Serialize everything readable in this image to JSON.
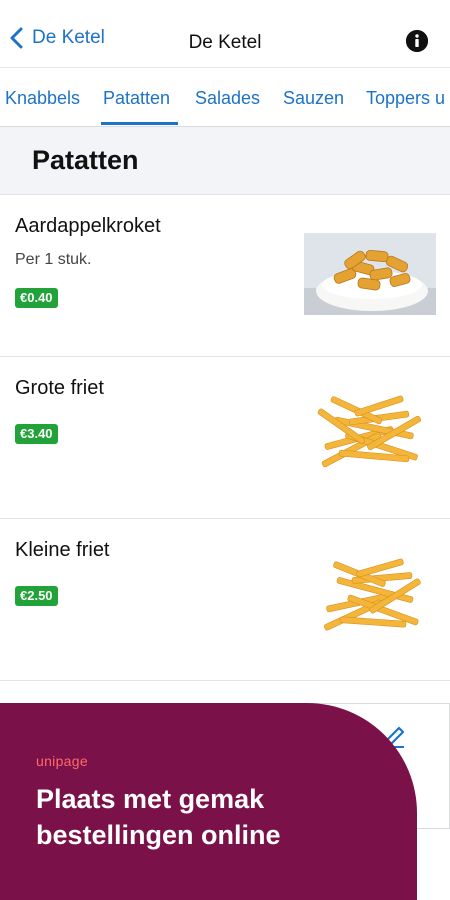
{
  "header": {
    "back_label": "De Ketel",
    "title": "De Ketel"
  },
  "tabs": [
    {
      "label": "Knabbels"
    },
    {
      "label": "Patatten",
      "active": true
    },
    {
      "label": "Salades"
    },
    {
      "label": "Sauzen"
    },
    {
      "label": "Toppers u"
    }
  ],
  "section": {
    "title": "Patatten"
  },
  "items": [
    {
      "name": "Aardappelkroket",
      "description": "Per 1 stuk.",
      "price": "€0.40"
    },
    {
      "name": "Grote friet",
      "description": "",
      "price": "€3.40"
    },
    {
      "name": "Kleine friet",
      "description": "",
      "price": "€2.50"
    }
  ],
  "banner": {
    "brand": "unipage",
    "headline": "Plaats met gemak bestellingen online"
  },
  "colors": {
    "accent": "#1c73c7",
    "price_badge": "#21a33a",
    "banner_bg": "#7a1148",
    "brand": "#ff6a6a"
  }
}
